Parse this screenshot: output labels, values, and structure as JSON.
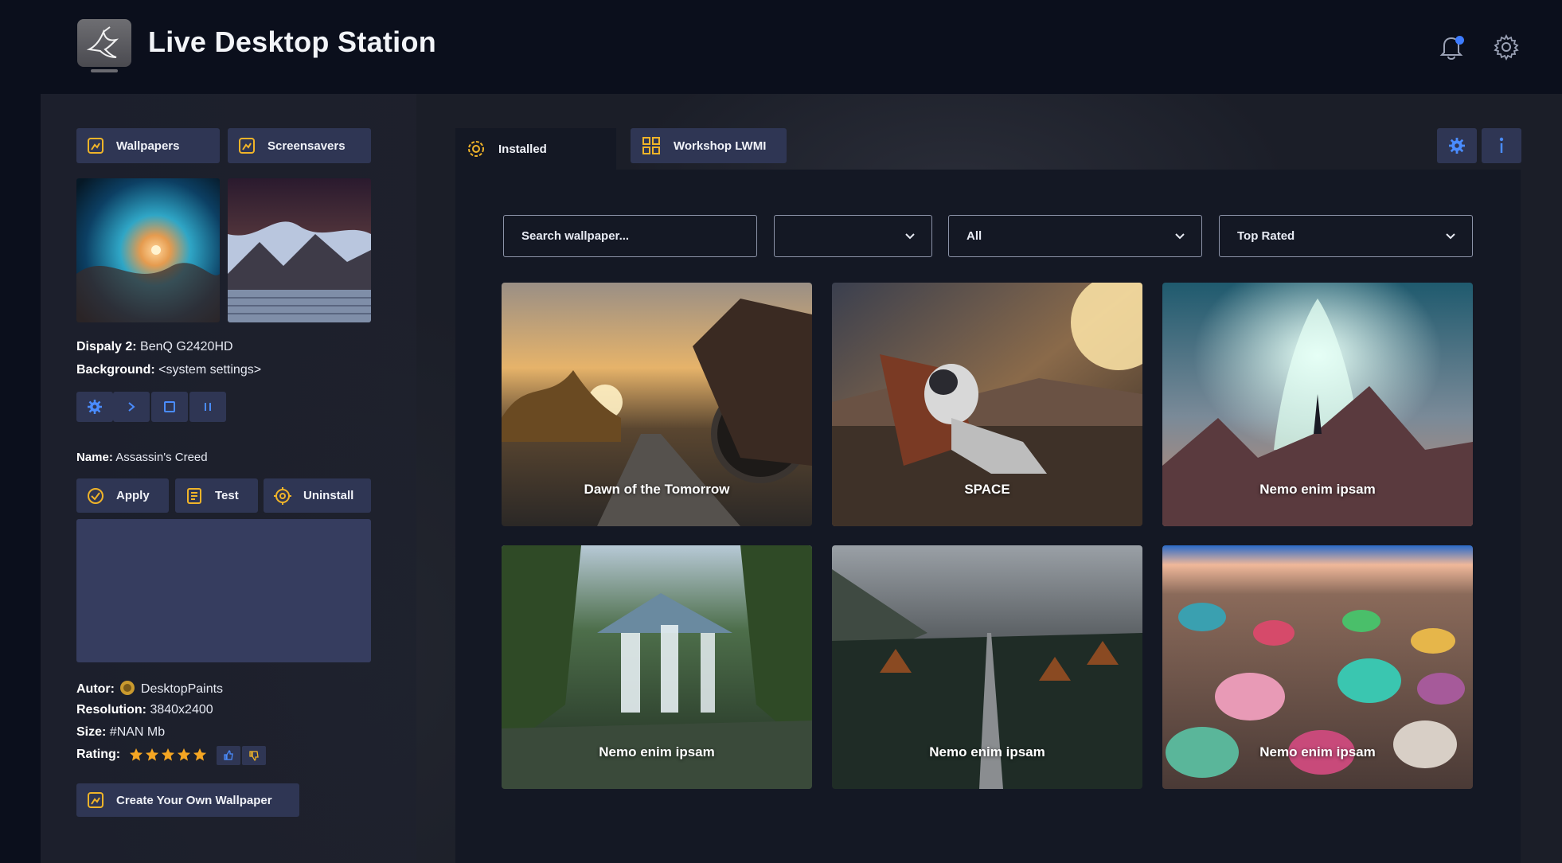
{
  "app": {
    "title": "Live Desktop Station"
  },
  "header": {
    "icons": [
      "notification-bell-icon",
      "settings-gear-icon"
    ],
    "notification_color": "#3d7bff"
  },
  "left": {
    "tabs": [
      {
        "label": "Wallpapers",
        "icon": "wallpaper-icon"
      },
      {
        "label": "Screensavers",
        "icon": "screensaver-icon"
      }
    ],
    "display_label": "Dispaly 2:",
    "display_value": "BenQ G2420HD",
    "background_label": "Background:",
    "background_value": "<system settings>",
    "controls": [
      "settings-icon",
      "play-icon",
      "stop-icon",
      "pause-icon"
    ],
    "name_label": "Name:",
    "name_value": "Assassin's Creed",
    "actions": [
      {
        "label": "Apply",
        "icon": "apply-icon"
      },
      {
        "label": "Test",
        "icon": "test-icon"
      },
      {
        "label": "Uninstall",
        "icon": "uninstall-icon"
      }
    ],
    "autor_label": "Autor:",
    "autor_value": "DesktopPaints",
    "resolution_label": "Resolution:",
    "resolution_value": "3840x2400",
    "size_label": "Size:",
    "size_value": "#NAN Mb",
    "rating_label": "Rating:",
    "rating_stars": 5,
    "create_label": "Create Your Own Wallpaper"
  },
  "right": {
    "tabs": [
      {
        "label": "Installed",
        "icon": "installed-gear-icon",
        "active": true
      },
      {
        "label": "Workshop LWMI",
        "icon": "workshop-icon",
        "active": false
      }
    ],
    "buttons": [
      "settings-icon",
      "info-icon"
    ],
    "search_placeholder": "Search wallpaper...",
    "filter1_value": "",
    "filter2_value": "All",
    "sort_value": "Top Rated",
    "cards": [
      {
        "title": "Dawn of the Tomorrow"
      },
      {
        "title": "SPACE"
      },
      {
        "title": "Nemo enim ipsam"
      },
      {
        "title": "Nemo enim ipsam"
      },
      {
        "title": "Nemo enim ipsam"
      },
      {
        "title": "Nemo enim ipsam"
      }
    ]
  },
  "colors": {
    "accent": "#3d7bff",
    "button_bg": "#2f3654",
    "icon_yellow": "#f0b429",
    "star": "#f5a623"
  }
}
